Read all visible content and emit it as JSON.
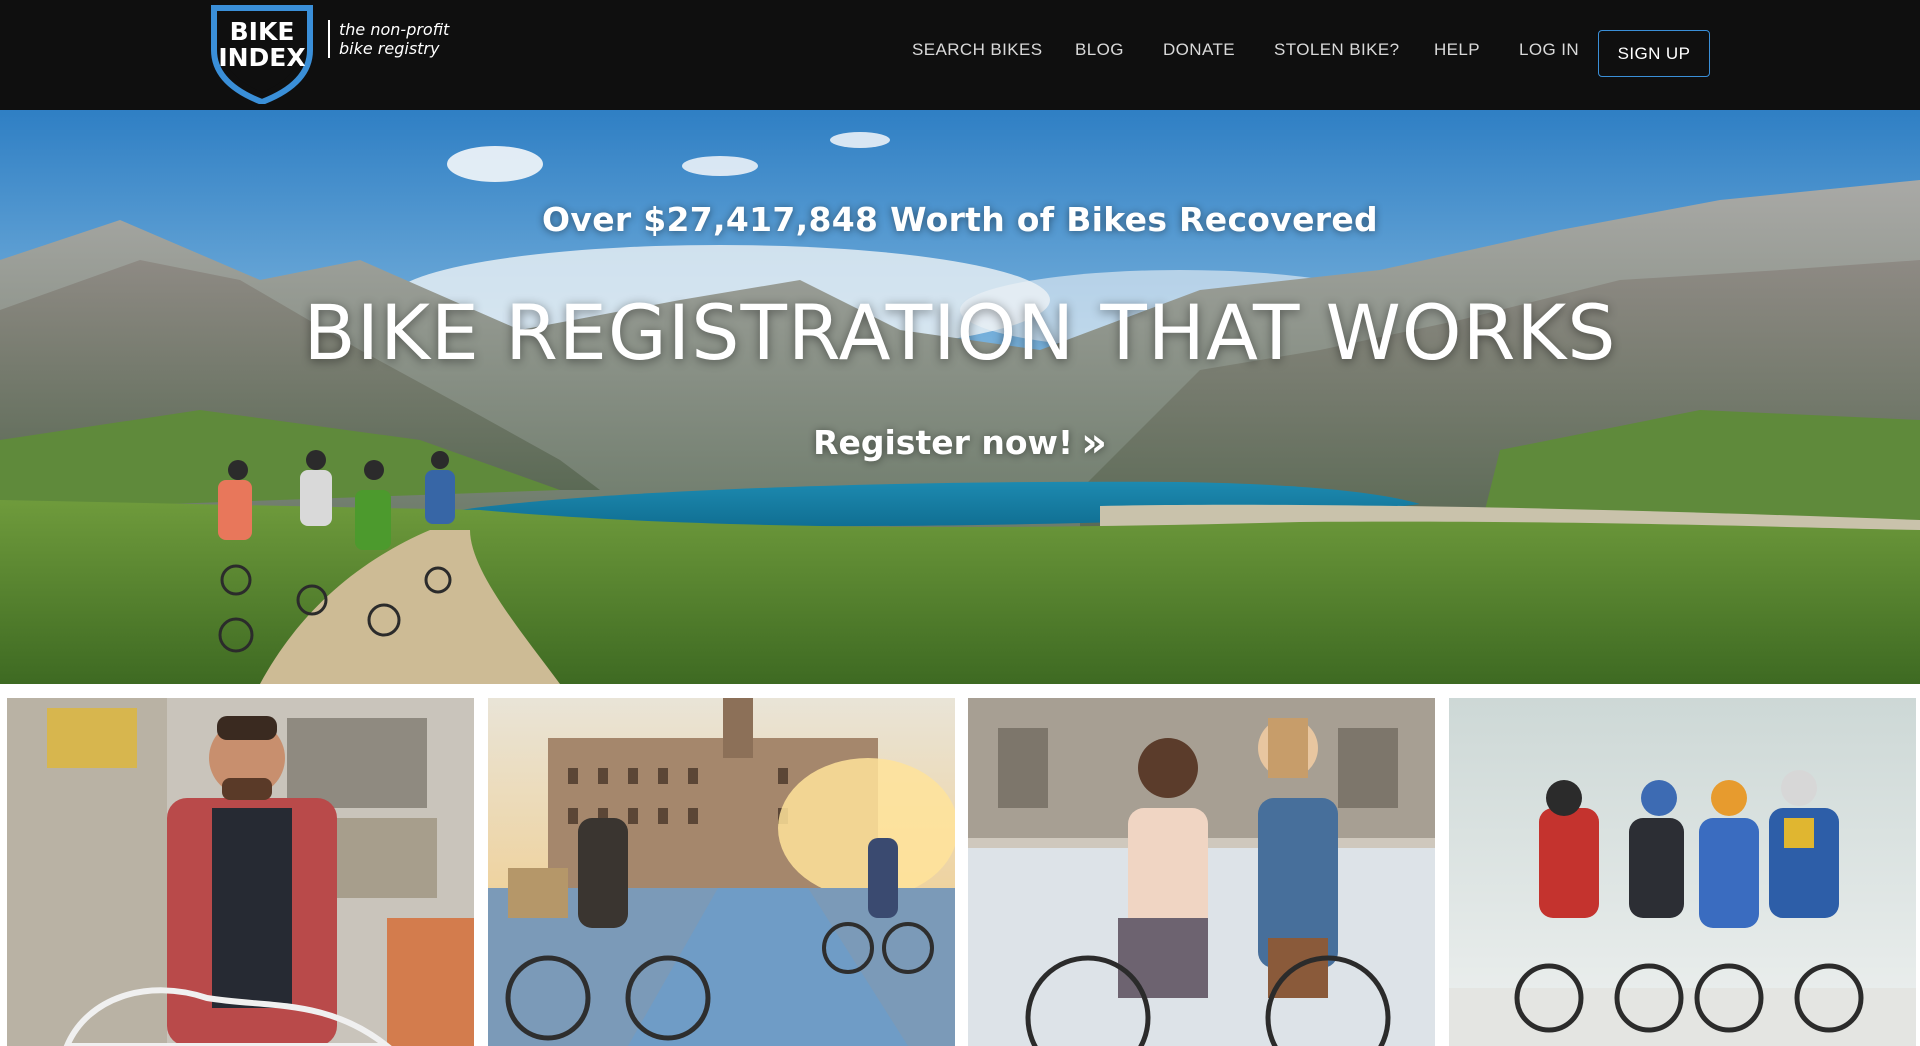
{
  "header": {
    "logo": {
      "line1": "BIKE",
      "line2": "INDEX",
      "tagline_line1": "the non-profit",
      "tagline_line2": "bike registry",
      "shield_color": "#3a8fd8"
    },
    "nav": {
      "search_bikes": "SEARCH BIKES",
      "blog": "BLOG",
      "donate": "DONATE",
      "stolen_bike": "STOLEN BIKE?",
      "help": "HELP",
      "log_in": "LOG IN",
      "sign_up": "SIGN UP"
    },
    "background_color": "#0f0f0f",
    "accent_color": "#3a8fd8"
  },
  "hero": {
    "stat_text": "Over $27,417,848 Worth of Bikes Recovered",
    "title": "BIKE REGISTRATION THAT WORKS",
    "cta_label": "Register now!",
    "cta_icon": "double-chevron-right-icon",
    "cta_glyph": "»"
  },
  "tiles": [
    {
      "name": "tile-shop-mechanic-photo"
    },
    {
      "name": "tile-city-commuters-photo"
    },
    {
      "name": "tile-friends-with-bike-photo"
    },
    {
      "name": "tile-cycling-team-photo"
    }
  ]
}
